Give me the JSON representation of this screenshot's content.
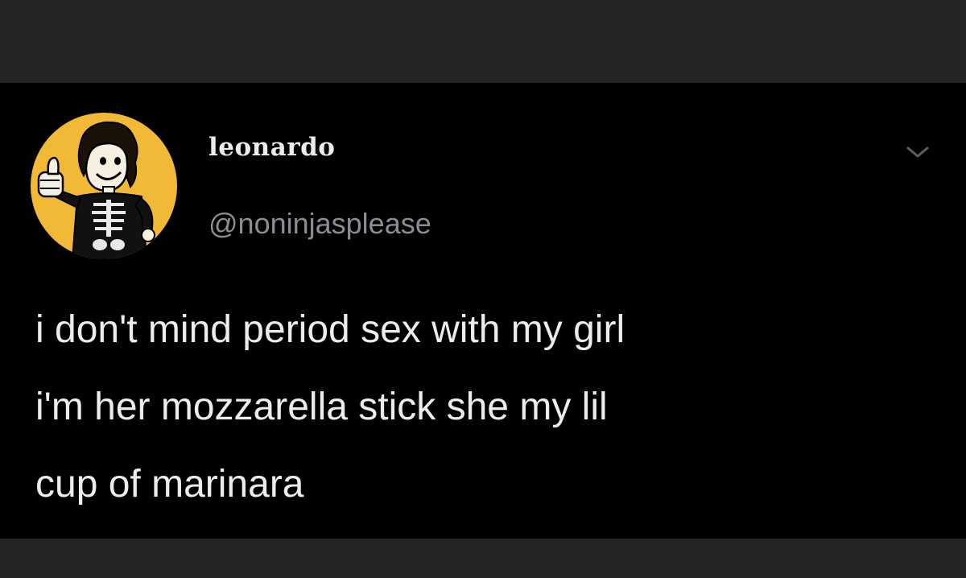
{
  "tweet": {
    "display_name": "leonardo",
    "handle": "@noninjasplease",
    "text_lines": [
      "i don't mind period sex with my girl",
      "i'm her mozzarella stick she my lil",
      "cup of marinara"
    ]
  },
  "icons": {
    "avatar": "vault-boy-thumbs-up-avatar",
    "more": "chevron-down-icon"
  },
  "colors": {
    "card_background": "#000000",
    "frame_background": "#252525",
    "avatar_background": "#f2b936",
    "primary_text": "#ececec",
    "secondary_text": "#8a8d91"
  }
}
